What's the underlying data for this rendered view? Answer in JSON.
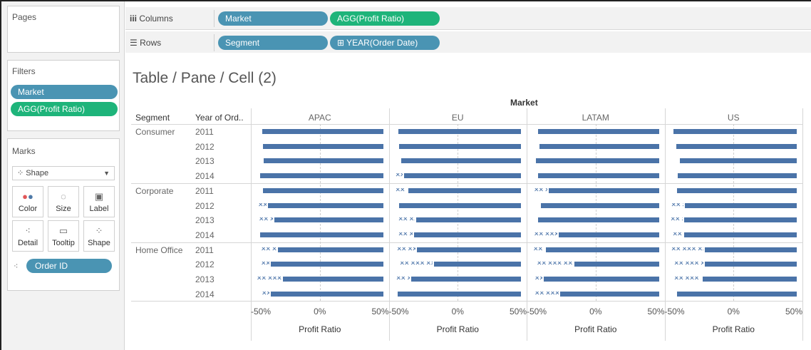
{
  "left": {
    "pages_title": "Pages",
    "filters_title": "Filters",
    "filters": [
      {
        "label": "Market",
        "color": "#4a94b3"
      },
      {
        "label": "AGG(Profit Ratio)",
        "color": "#1eb47a"
      }
    ],
    "marks_title": "Marks",
    "mark_type": "Shape",
    "mark_buttons": [
      {
        "label": "Color",
        "icon": "color-dots-icon"
      },
      {
        "label": "Size",
        "icon": "size-icon"
      },
      {
        "label": "Label",
        "icon": "label-icon"
      },
      {
        "label": "Detail",
        "icon": "detail-icon"
      },
      {
        "label": "Tooltip",
        "icon": "tooltip-icon"
      },
      {
        "label": "Shape",
        "icon": "shape-icon"
      }
    ],
    "detail_pill": "Order ID"
  },
  "shelves": {
    "columns_label": "Columns",
    "columns_pills": [
      "Market",
      "AGG(Profit Ratio)"
    ],
    "rows_label": "Rows",
    "rows_pills": [
      "Segment",
      "⊞ YEAR(Order Date)"
    ]
  },
  "view": {
    "title": "Table / Pane / Cell (2)",
    "col_header_title": "Market",
    "row_header_segment": "Segment",
    "row_header_year": "Year of Ord..",
    "axis_title": "Profit Ratio"
  },
  "chart_data": {
    "type": "scatter",
    "mark_shape": "x",
    "columns": [
      "APAC",
      "EU",
      "LATAM",
      "US"
    ],
    "segments": [
      "Consumer",
      "Corporate",
      "Home Office"
    ],
    "years": [
      "2011",
      "2012",
      "2013",
      "2014"
    ],
    "x_ticks": [
      "-50%",
      "0%",
      "50%"
    ],
    "xlim": [
      -0.5,
      0.5
    ],
    "ylabel": "",
    "xlabel": "Profit Ratio",
    "color": "#4a73a8"
  }
}
